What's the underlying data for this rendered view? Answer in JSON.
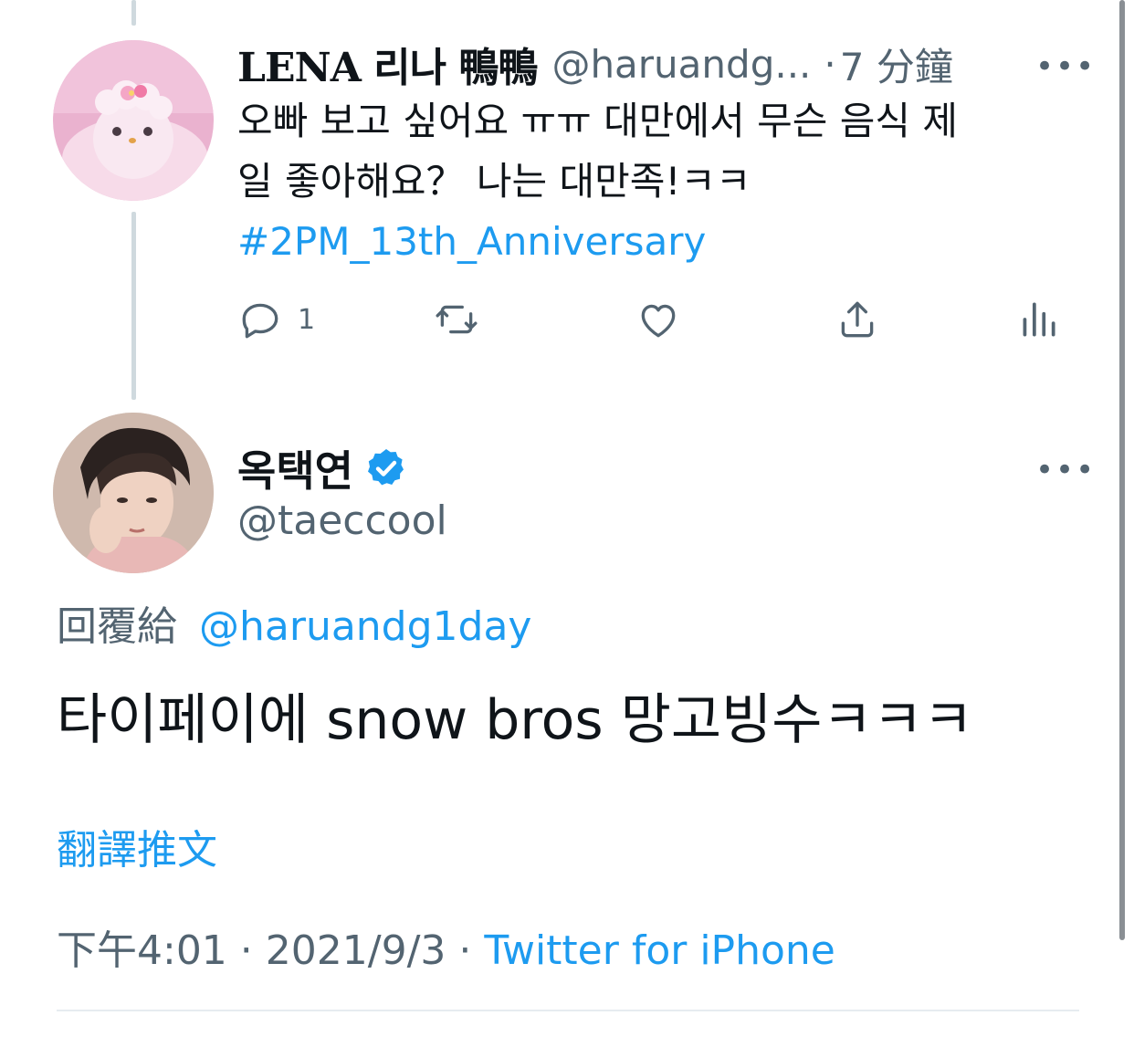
{
  "parent_tweet": {
    "display_name": "LENA 리나 鴨鴨",
    "handle": "@haruandg...",
    "separator": "·",
    "time": "7 分鐘",
    "text_line1": "오빠 보고 싶어요 ㅠㅠ 대만에서 무슨 음식 제",
    "text_line2": "일 좋아해요？ 나는 대만족!ㅋㅋ",
    "hashtag": "#2PM_13th_Anniversary",
    "actions": {
      "reply_count": "1",
      "reply_icon": "reply-icon",
      "retweet_icon": "retweet-icon",
      "like_icon": "heart-icon",
      "share_icon": "share-icon",
      "analytics_icon": "analytics-icon"
    }
  },
  "main_tweet": {
    "display_name": "옥택연",
    "handle": "@taeccool",
    "verified_icon": "verified-badge-icon",
    "reply_prefix": "回覆給",
    "reply_handle": "@haruandg1day",
    "text": "타이페이에 snow bros 망고빙수ㅋㅋㅋ",
    "translate_label": "翻譯推文",
    "meta_time": "下午4:01",
    "meta_sep1": " · ",
    "meta_date": "2021/9/3",
    "meta_sep2": " · ",
    "meta_source": "Twitter for iPhone"
  },
  "more_icon": "more-options-icon",
  "colors": {
    "link": "#1d9bf0",
    "muted": "#536471",
    "text": "#0f1419",
    "verified": "#1d9bf0",
    "thread_line": "#cfd9de"
  }
}
